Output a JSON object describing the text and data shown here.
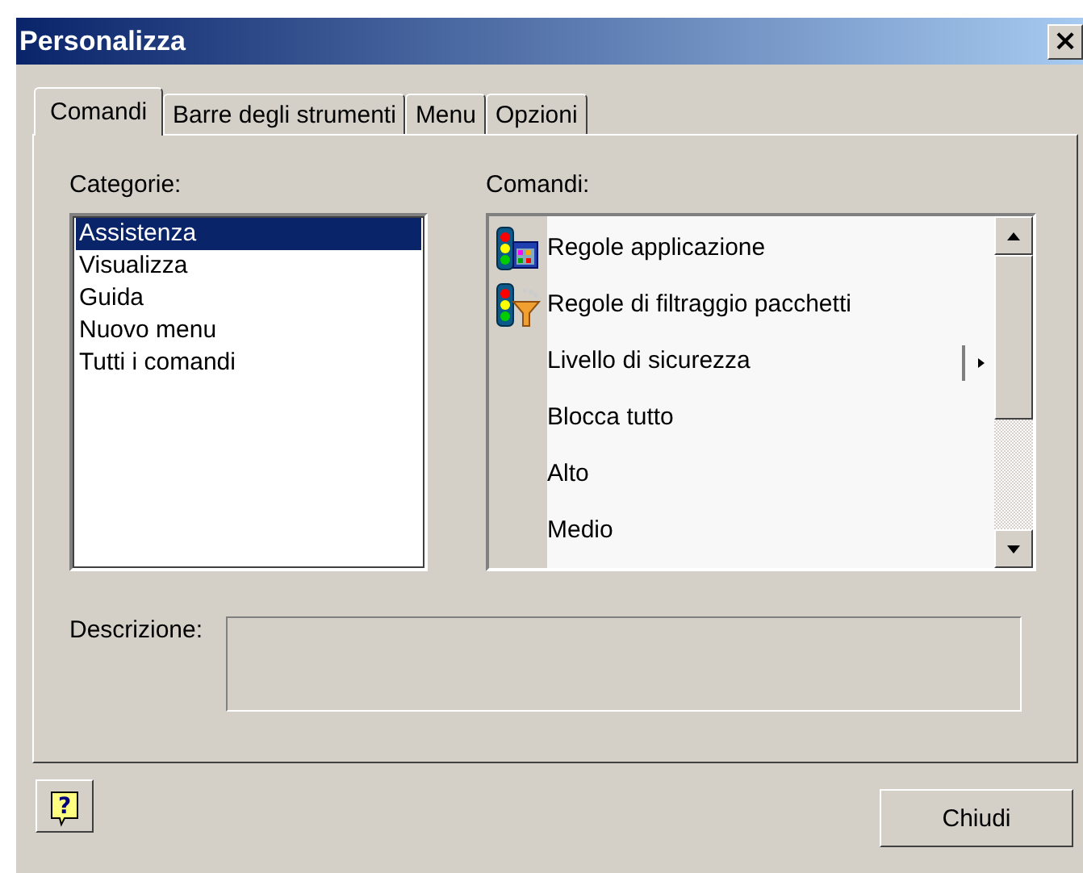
{
  "window": {
    "title": "Personalizza",
    "close": "×"
  },
  "tabs": [
    {
      "label": "Comandi",
      "selected": true
    },
    {
      "label": "Barre degli strumenti",
      "selected": false
    },
    {
      "label": "Menu",
      "selected": false
    },
    {
      "label": "Opzioni",
      "selected": false
    }
  ],
  "categories": {
    "label": "Categorie:",
    "items": [
      {
        "label": "Assistenza",
        "selected": true
      },
      {
        "label": "Visualizza",
        "selected": false
      },
      {
        "label": "Guida",
        "selected": false
      },
      {
        "label": "Nuovo menu",
        "selected": false
      },
      {
        "label": "Tutti i comandi",
        "selected": false
      }
    ]
  },
  "commands": {
    "label": "Comandi:",
    "items": [
      {
        "label": "Regole applicazione",
        "kind": "app"
      },
      {
        "label": "Regole di filtraggio pacchetti",
        "kind": "filter"
      },
      {
        "label": "Livello di sicurezza",
        "kind": "submenu"
      },
      {
        "label": "Blocca tutto",
        "kind": "plain"
      },
      {
        "label": "Alto",
        "kind": "plain"
      },
      {
        "label": "Medio",
        "kind": "plain"
      }
    ]
  },
  "description": {
    "label": "Descrizione:"
  },
  "buttons": {
    "help": "?",
    "close": "Chiudi"
  }
}
